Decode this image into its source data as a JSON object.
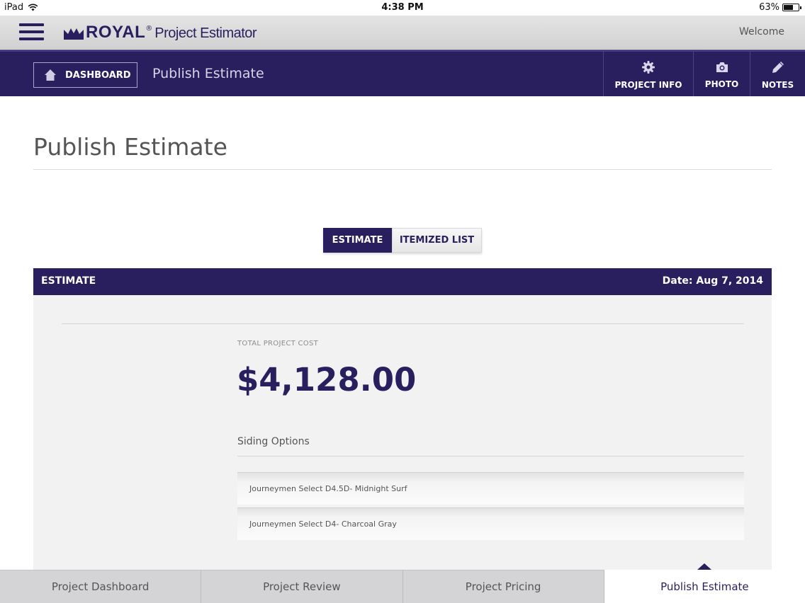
{
  "statusbar": {
    "device": "iPad",
    "time": "4:38 PM",
    "battery": "63%",
    "battery_level": 0.63
  },
  "header": {
    "brand": "ROYAL",
    "registered": "®",
    "product": "Project Estimator",
    "welcome": "Welcome"
  },
  "nav": {
    "dashboard_label": "DASHBOARD",
    "title": "Publish Estimate",
    "actions": {
      "project_info": "PROJECT INFO",
      "photo": "PHOTO",
      "notes": "NOTES"
    }
  },
  "page": {
    "title": "Publish Estimate"
  },
  "toggle": {
    "estimate": "ESTIMATE",
    "itemized": "ITEMIZED LIST"
  },
  "estimate": {
    "bar_label": "ESTIMATE",
    "date": "Date: Aug 7, 2014",
    "total_label": "TOTAL PROJECT COST",
    "total_value": "$4,128.00",
    "options_title": "Siding Options",
    "options": [
      "Journeymen Select D4.5D- Midnight Surf",
      "Journeymen Select D4- Charcoal Gray"
    ]
  },
  "tabs": [
    "Project Dashboard",
    "Project Review",
    "Project Pricing",
    "Publish Estimate"
  ],
  "colors": {
    "brand": "#2a1f5e",
    "header_bg": "#dcdcdc",
    "panel_bg": "#f2f2f2"
  }
}
